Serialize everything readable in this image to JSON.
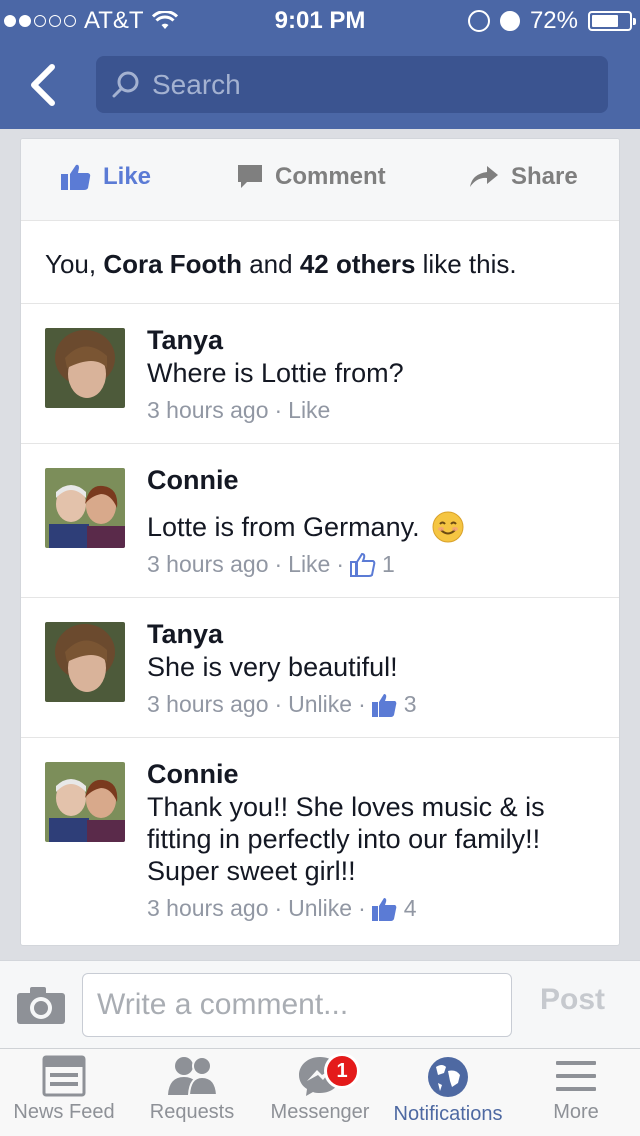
{
  "status_bar": {
    "carrier": "AT&T",
    "time": "9:01 PM",
    "battery": "72%",
    "battery_level": 0.72,
    "signal_bars": 2
  },
  "header": {
    "search_placeholder": "Search",
    "color": "#4b67a6"
  },
  "post_actions": {
    "like": "Like",
    "comment": "Comment",
    "share": "Share",
    "like_color": "#5b7bd5"
  },
  "likes_summary": {
    "prefix": "You, ",
    "name": "Cora Footh",
    "middle": " and ",
    "others": "42 others",
    "suffix": " like this."
  },
  "comments": [
    {
      "name": "Tanya",
      "text": "Where is Lottie from?",
      "time": "3 hours ago",
      "action": "Like",
      "likes": null
    },
    {
      "name": "Connie",
      "text": "Lotte is from Germany.",
      "emoji": "😊",
      "time": "3 hours ago",
      "action": "Like",
      "likes": "1"
    },
    {
      "name": "Tanya",
      "text": "She is very beautiful!",
      "time": "3 hours ago",
      "action": "Unlike",
      "likes": "3"
    },
    {
      "name": "Connie",
      "text": "Thank you!! She loves music & is fitting in perfectly into our family!! Super sweet girl!!",
      "time": "3 hours ago",
      "action": "Unlike",
      "likes": "4"
    }
  ],
  "composer": {
    "placeholder": "Write a comment...",
    "post": "Post"
  },
  "tabs": [
    {
      "label": "News Feed",
      "icon": "news-feed-icon"
    },
    {
      "label": "Requests",
      "icon": "requests-icon"
    },
    {
      "label": "Messenger",
      "icon": "messenger-icon",
      "badge": "1"
    },
    {
      "label": "Notifications",
      "icon": "globe-icon",
      "active": true
    },
    {
      "label": "More",
      "icon": "menu-icon"
    }
  ]
}
